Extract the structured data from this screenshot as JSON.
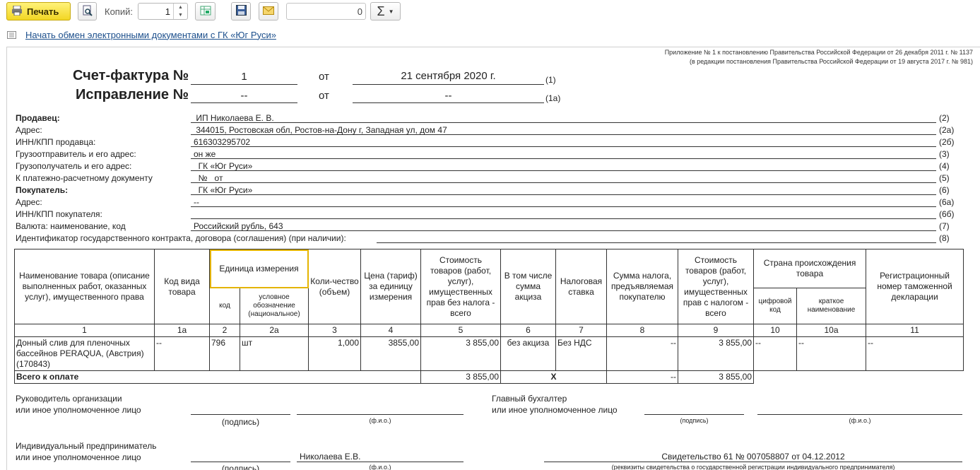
{
  "toolbar": {
    "print_label": "Печать",
    "copies_label": "Копий:",
    "copies_value": "1",
    "sum_value": "0",
    "sum_symbol": "Σ"
  },
  "link": {
    "text": "Начать обмен электронными документами с  ГК «Юг Руси»"
  },
  "document": {
    "annex_line1": "Приложение № 1 к постановлению Правительства Российской Федерации от 26 декабря 2011 г. № 1137",
    "annex_line2": "(в редакции постановления Правительства Российской Федерации от 19 августа 2017 г. № 981)",
    "invoice_title": "Счет-фактура №",
    "invoice_number": "1",
    "from_label": "от",
    "invoice_date": "21 сентября 2020 г.",
    "code_1": "(1)",
    "correction_title": "Исправление №",
    "correction_number": "--",
    "correction_date": "--",
    "code_1a": "(1а)",
    "fields": [
      {
        "label": "Продавец:",
        "value": " ИП Николаева Е. В.",
        "code": "(2)",
        "bold": true
      },
      {
        "label": "Адрес:",
        "value": " 344015, Ростовская обл, Ростов-на-Дону г, Западная ул, дом 47",
        "code": "(2а)",
        "bold": false
      },
      {
        "label": "ИНН/КПП продавца:",
        "value": "616303295702",
        "code": "(2б)",
        "bold": false
      },
      {
        "label": "Грузоотправитель и его адрес:",
        "value": "он же",
        "code": "(3)",
        "bold": false
      },
      {
        "label": "Грузополучатель и его адрес:",
        "value": "  ГК «Юг Руси»",
        "code": "(4)",
        "bold": false
      },
      {
        "label": "К платежно-расчетному документу",
        "value": "  №   от",
        "code": "(5)",
        "bold": false
      },
      {
        "label": "Покупатель:",
        "value": "  ГК «Юг Руси»",
        "code": "(6)",
        "bold": true
      },
      {
        "label": "Адрес:",
        "value": "--",
        "code": "(6а)",
        "bold": false
      },
      {
        "label": "ИНН/КПП покупателя:",
        "value": "",
        "code": "(6б)",
        "bold": false
      },
      {
        "label": "Валюта: наименование, код",
        "value": "Российский рубль, 643",
        "code": "(7)",
        "bold": false
      }
    ],
    "contract_label": "Идентификатор государственного контракта, договора (соглашения) (при наличии):",
    "contract_code": "(8)",
    "table": {
      "h_name": "Наименование товара (описание выполненных работ, оказанных услуг), имущественного права",
      "h_kind": "Код вида товара",
      "h_unit": "Единица измерения",
      "h_unit_code": "код",
      "h_unit_name": "условное обозначение (национальное)",
      "h_qty": "Коли-чество (объем)",
      "h_price": "Цена (тариф) за единицу измерения",
      "h_cost": "Стоимость товаров (работ, услуг), имущественных прав без налога - всего",
      "h_excise": "В том числе сумма акциза",
      "h_rate": "Налоговая ставка",
      "h_tax": "Сумма налога, предъявляемая покупателю",
      "h_total": "Стоимость товаров (работ, услуг), имущественных прав с налогом - всего",
      "h_country": "Страна происхождения товара",
      "h_country_code": "цифровой код",
      "h_country_name": "краткое наименование",
      "h_decl": "Регистрационный номер таможенной декларации",
      "nums": [
        "1",
        "1а",
        "2",
        "2а",
        "3",
        "4",
        "5",
        "6",
        "7",
        "8",
        "9",
        "10",
        "10а",
        "11"
      ],
      "rows": [
        {
          "name": "Донный слив для пленочных бассейнов  PERAQUA, (Австрия) (170843)",
          "kind": "--",
          "unit_code": "796",
          "unit_name": "шт",
          "qty": "1,000",
          "price": "3855,00",
          "cost": "3 855,00",
          "excise": "без акциза",
          "rate": "Без НДС",
          "tax": "--",
          "total": "3 855,00",
          "country_code": "--",
          "country_name": "--",
          "decl": "--"
        }
      ],
      "total_label": "Всего к оплате",
      "total_cost": "3 855,00",
      "total_excise": "X",
      "total_tax": "--",
      "total_sum": "3 855,00"
    },
    "sign": {
      "head_line1": "Руководитель организации",
      "head_line2": "или иное уполномоченное лицо",
      "chief_line1": "Главный бухгалтер",
      "chief_line2": "или иное уполномоченное лицо",
      "signature": "(подпись)",
      "fio": "(ф.и.о.)",
      "ip_line1": "Индивидуальный предприниматель",
      "ip_line2": "или иное уполномоченное лицо",
      "ip_name": "Николаева  Е.В.",
      "cert": "Свидетельство 61 № 007058807 от 04.12.2012",
      "cert_caption": "(реквизиты свидетельства о государственной регистрации индивидуального предпринимателя)"
    }
  }
}
